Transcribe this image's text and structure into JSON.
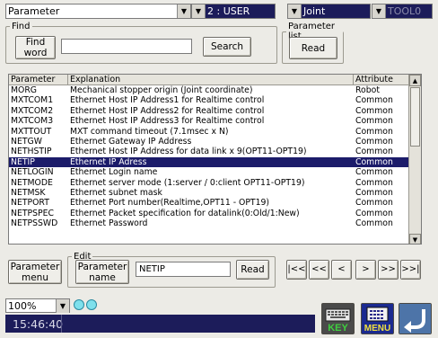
{
  "toolbar": {
    "parameter_dropdown": "Parameter",
    "user_dropdown": "2 : USER",
    "joint_dropdown": "Joint",
    "tool_dropdown": "TOOL0"
  },
  "find": {
    "legend": "Find",
    "find_word_label": [
      "Find",
      "word"
    ],
    "input_value": "",
    "search_label": "Search"
  },
  "parameter_list": {
    "legend": "Parameter list",
    "read_label": "Read"
  },
  "table": {
    "headers": [
      "Parameter",
      "Explanation",
      "Attribute"
    ],
    "rows": [
      [
        "MORG",
        "Mechanical stopper origin (Joint coordinate)",
        "Robot"
      ],
      [
        "MXTCOM1",
        "Ethernet Host IP Address1 for Realtime control",
        "Common"
      ],
      [
        "MXTCOM2",
        "Ethernet Host IP Address2 for Realtime control",
        "Common"
      ],
      [
        "MXTCOM3",
        "Ethernet Host IP Address3 for Realtime control",
        "Common"
      ],
      [
        "MXTTOUT",
        "MXT command timeout (7.1msec x N)",
        "Common"
      ],
      [
        "NETGW",
        "Ethernet Gateway IP Address",
        "Common"
      ],
      [
        "NETHSTIP",
        "Ethernet Host IP Address for data link x 9(OPT11-OPT19)",
        "Common"
      ],
      [
        "NETIP",
        "Ethernet IP Adress",
        "Common"
      ],
      [
        "NETLOGIN",
        "Ethernet Login name",
        "Common"
      ],
      [
        "NETMODE",
        "Ethernet server mode (1:server / 0:client OPT11-OPT19)",
        "Common"
      ],
      [
        "NETMSK",
        "Ethernet subnet mask",
        "Common"
      ],
      [
        "NETPORT",
        "Ethernet Port number(Realtime,OPT11 - OPT19)",
        "Common"
      ],
      [
        "NETPSPEC",
        "Ethernet Packet specification for datalink(0:Old/1:New)",
        "Common"
      ],
      [
        "NETPSSWD",
        "Ethernet Password",
        "Common"
      ]
    ],
    "selected_index": 7
  },
  "bottom": {
    "parameter_menu_label": [
      "Parameter",
      "menu"
    ],
    "edit_legend": "Edit",
    "parameter_name_label": [
      "Parameter",
      "name"
    ],
    "edit_value": "NETIP",
    "read_label": "Read",
    "nav": [
      "|<<",
      "<<",
      "<",
      ">",
      ">>",
      ">>|"
    ]
  },
  "status": {
    "zoom": "100%",
    "time": "15:46:40",
    "key_label": "KEY",
    "menu_label": "MENU"
  },
  "colors": {
    "selection": "#1c1c6a",
    "status_bar": "#1c1c5a",
    "indicator": "#7ee0ec",
    "key_text": "#3fcf3f",
    "menu_text": "#f0e040"
  }
}
